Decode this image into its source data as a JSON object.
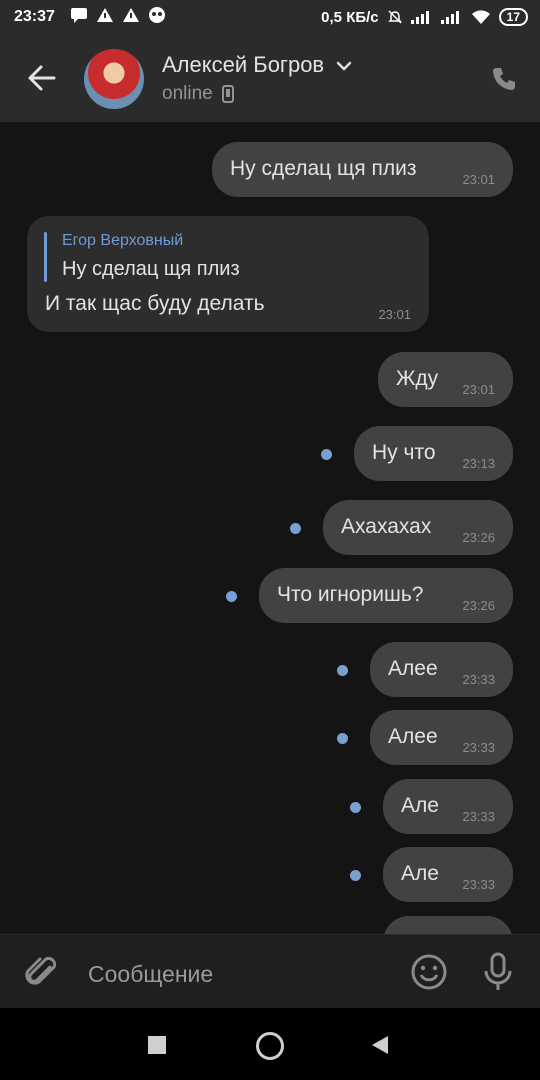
{
  "statusbar": {
    "time": "23:37",
    "speed": "0,5 КБ/с",
    "battery": "17"
  },
  "header": {
    "name": "Алексей Богров",
    "status": "online"
  },
  "reply": {
    "author": "Егор Верховный",
    "quoted": "Ну сделац щя плиз",
    "text": "И так щас буду делать",
    "time": "23:01"
  },
  "messages": [
    {
      "text": "Ну сделац щя плиз",
      "time": "23:01"
    },
    {
      "text": "Жду",
      "time": "23:01"
    },
    {
      "text": "Ну что",
      "time": "23:13"
    },
    {
      "text": "Ахахахах",
      "time": "23:26"
    },
    {
      "text": "Что игноришь?",
      "time": "23:26"
    },
    {
      "text": "Алее",
      "time": "23:33"
    },
    {
      "text": "Алее",
      "time": "23:33"
    },
    {
      "text": "Але",
      "time": "23:33"
    },
    {
      "text": "Але",
      "time": "23:33"
    }
  ],
  "composer": {
    "placeholder": "Сообщение"
  }
}
